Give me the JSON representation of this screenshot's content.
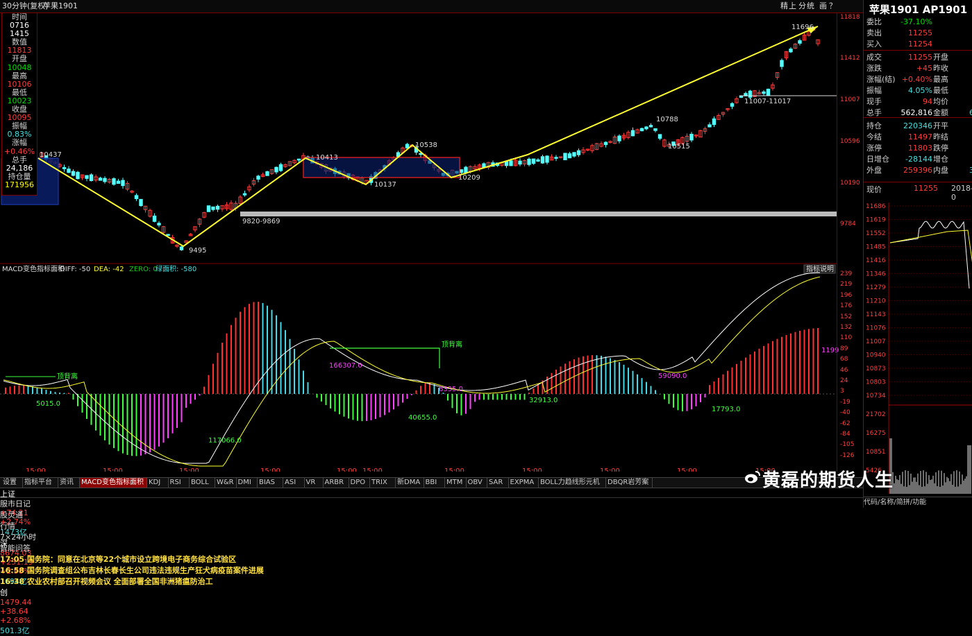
{
  "topbar": {
    "period": "30分钟(复权)",
    "name": "苹果1901",
    "tools": [
      "精",
      "上",
      "分",
      "统",
      "画",
      "？"
    ]
  },
  "infobox": [
    {
      "label": "时间",
      "value": "0716",
      "value2": "1415",
      "cls": "white"
    },
    {
      "label": "数值",
      "value": "11813",
      "cls": "red"
    },
    {
      "label": "开盘",
      "value": "10048",
      "cls": "grn"
    },
    {
      "label": "最高",
      "value": "10106",
      "cls": "red"
    },
    {
      "label": "最低",
      "value": "10023",
      "cls": "grn"
    },
    {
      "label": "收盘",
      "value": "10095",
      "cls": "red"
    },
    {
      "label": "振幅",
      "value": "0.83%",
      "cls": "cyan"
    },
    {
      "label": "涨幅",
      "value": "+0.46%",
      "cls": "red"
    },
    {
      "label": "总手",
      "value": "24,186",
      "cls": "white"
    },
    {
      "label": "持仓量",
      "value": "171956",
      "cls": "yel"
    }
  ],
  "main_annotations": {
    "peak_label": "11696",
    "range_label": "11007-11017",
    "l10788": "10788",
    "l10515": "10515",
    "l10538": "10538",
    "l10413": "10413",
    "l10137": "10137",
    "l10209": "10209",
    "l10437": "10437",
    "l9495": "9495",
    "support_label": "9820-9869"
  },
  "price_axis": [
    "11818",
    "11412",
    "11007",
    "10596",
    "10190",
    "9784"
  ],
  "macd": {
    "title": "MACD变色指标面积",
    "diff": "DIFF: -50",
    "dea": "DEA: -42",
    "zero": "ZERO: 0",
    "green_area": "绿面积: -580",
    "explain_btn": "指标说明",
    "div_top_left": "顶背离",
    "div_top_mid": "顶背离",
    "areas": [
      "5015.0",
      "117066.0",
      "166307.0",
      "40655.0",
      "6335.0",
      "32913.0",
      "59090.0",
      "17793.0",
      "1199"
    ],
    "axis": [
      "239",
      "219",
      "196",
      "176",
      "152",
      "132",
      "110",
      "89",
      "68",
      "46",
      "24",
      "3",
      "-19",
      "-40",
      "-62",
      "-84",
      "-105",
      "-126"
    ]
  },
  "time_labels": [
    "15:00",
    "15:00",
    "15:00",
    "15:00",
    "15:00",
    "15:00",
    "15:00",
    "15:00",
    "15:00",
    "15:00",
    "15:00"
  ],
  "tabs": [
    "设置",
    "指标平台",
    "资讯",
    "MACD变色指标面积",
    "KDJ",
    "RSI",
    "BOLL",
    "W&R",
    "DMI",
    "BIAS",
    "ASI",
    "VR",
    "ARBR",
    "DPO",
    "TRIX",
    "新DMA",
    "BBI",
    "MTM",
    "OBV",
    "SAR",
    "EXPMA",
    "BOLL力趋线形元机",
    "DBQR岩芳案"
  ],
  "statusbar": [
    {
      "text": "上证",
      "cls": "white"
    },
    {
      "text": "2779.37",
      "cls": "red"
    },
    {
      "text": "+74.21",
      "cls": "red"
    },
    {
      "text": "+2.74%",
      "cls": "red"
    },
    {
      "text": "1473亿",
      "cls": "cyan"
    },
    {
      "text": "深",
      "cls": "white"
    },
    {
      "text": "8674.03",
      "cls": "red"
    },
    {
      "text": "+251.19",
      "cls": "red"
    },
    {
      "text": "+2.98%",
      "cls": "red"
    },
    {
      "text": "1694亿",
      "cls": "cyan"
    },
    {
      "text": "创",
      "cls": "white"
    },
    {
      "text": "1479.44",
      "cls": "red"
    },
    {
      "text": "+38.64",
      "cls": "red"
    },
    {
      "text": "+2.68%",
      "cls": "red"
    },
    {
      "text": "501.3亿",
      "cls": "cyan"
    }
  ],
  "newsbar": {
    "tabs": [
      "服市日记",
      "股灵通",
      "行情",
      "7×24小时",
      "智能问答"
    ],
    "items": [
      "17:05 国务院：同意在北京等22个城市设立跨境电子商务综合试验区",
      "16:58 国务院调查组公布吉林长春长生公司违法违规生产狂犬病疫苗案件进展",
      "16:38 农业农村部召开视频会议 全面部署全国非洲猪瘟防治工"
    ]
  },
  "right_panel": {
    "title": "苹果1901 AP1901",
    "rows": [
      {
        "k": "委比",
        "v": "-37.10%",
        "vc": "grn"
      },
      {
        "k": "卖出",
        "v": "11255",
        "vc": "red"
      },
      {
        "k": "买入",
        "v": "11254",
        "vc": "red"
      },
      {
        "k": "成交",
        "v": "11255",
        "vc": "red",
        "k2": "开盘",
        "v2": ""
      },
      {
        "k": "涨跌",
        "v": "+45",
        "vc": "red",
        "k2": "昨收",
        "v2": ""
      },
      {
        "k": "涨幅(结)",
        "v": "+0.40%",
        "vc": "red",
        "k2": "最高",
        "v2": ""
      },
      {
        "k": "振幅",
        "v": "4.05%",
        "vc": "cyan",
        "k2": "最低",
        "v2": ""
      },
      {
        "k": "现手",
        "v": "94",
        "vc": "red",
        "k2": "均价",
        "v2": ""
      },
      {
        "k": "总手",
        "v": "562,816",
        "vc": "white",
        "k2": "金额",
        "v2": "6"
      },
      {
        "k": "持仓",
        "v": "220346",
        "vc": "cyan",
        "k2": "开平",
        "v2": ""
      },
      {
        "k": "今结",
        "v": "11497",
        "vc": "red",
        "k2": "昨结",
        "v2": ""
      },
      {
        "k": "涨停",
        "v": "11803",
        "vc": "red",
        "k2": "跌停",
        "v2": ""
      },
      {
        "k": "日增仓",
        "v": "-28144",
        "vc": "cyan",
        "k2": "增仓",
        "v2": ""
      },
      {
        "k": "外盘",
        "v": "259396",
        "vc": "red",
        "k2": "内盘",
        "v2": "3"
      }
    ],
    "now_label": "现价",
    "now_value": "11255",
    "date": "2018-0",
    "mini_axis": [
      "11686",
      "11619",
      "11552",
      "11485",
      "11416",
      "11346",
      "11279",
      "11210",
      "11143",
      "11076",
      "11007",
      "10940",
      "10873",
      "10803",
      "10734"
    ],
    "vol_axis": [
      "21702",
      "16275",
      "10851",
      "5426"
    ],
    "footer": "代码/名称/简拼/功能"
  },
  "watermark": "黄磊的期货人生"
}
